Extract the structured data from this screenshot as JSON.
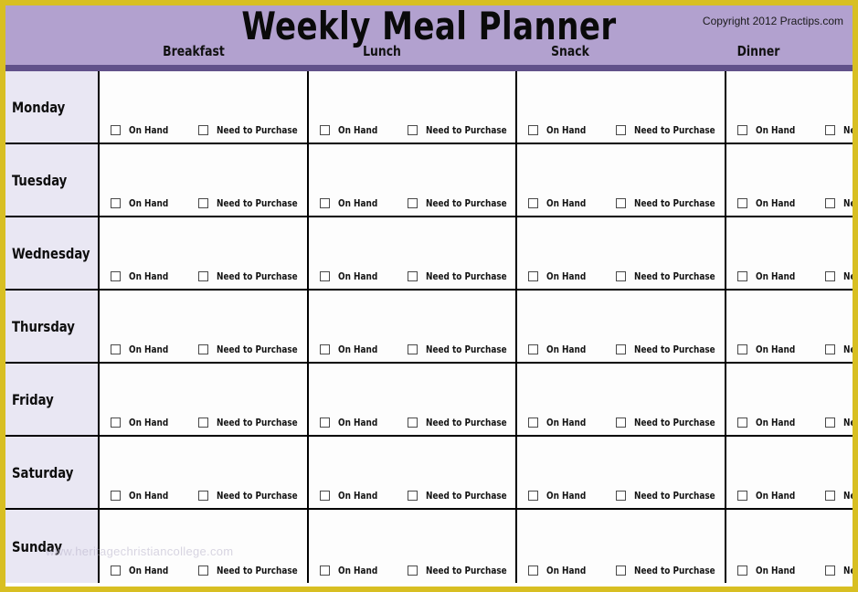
{
  "header": {
    "title": "Weekly Meal Planner",
    "copyright": "Copyright 2012 Practips.com"
  },
  "meals": [
    {
      "label": "Breakfast"
    },
    {
      "label": "Lunch"
    },
    {
      "label": "Snack"
    },
    {
      "label": "Dinner"
    }
  ],
  "days": [
    {
      "label": "Monday"
    },
    {
      "label": "Tuesday"
    },
    {
      "label": "Wednesday"
    },
    {
      "label": "Thursday"
    },
    {
      "label": "Friday"
    },
    {
      "label": "Saturday"
    },
    {
      "label": "Sunday"
    }
  ],
  "checkboxes": {
    "on_hand_label": "On Hand",
    "need_to_purchase_label": "Need to Purchase",
    "checked": false
  },
  "watermark": "www.heritagechristiancollege.com",
  "colors": {
    "outer_border": "#d8bf22",
    "header_band": "#b2a1cf",
    "header_rule": "#61518a",
    "day_cell_bg": "#e9e7f3",
    "meal_cell_bg": "#fdfdfd",
    "grid_line": "#000000",
    "text": "#0d0d0d"
  }
}
